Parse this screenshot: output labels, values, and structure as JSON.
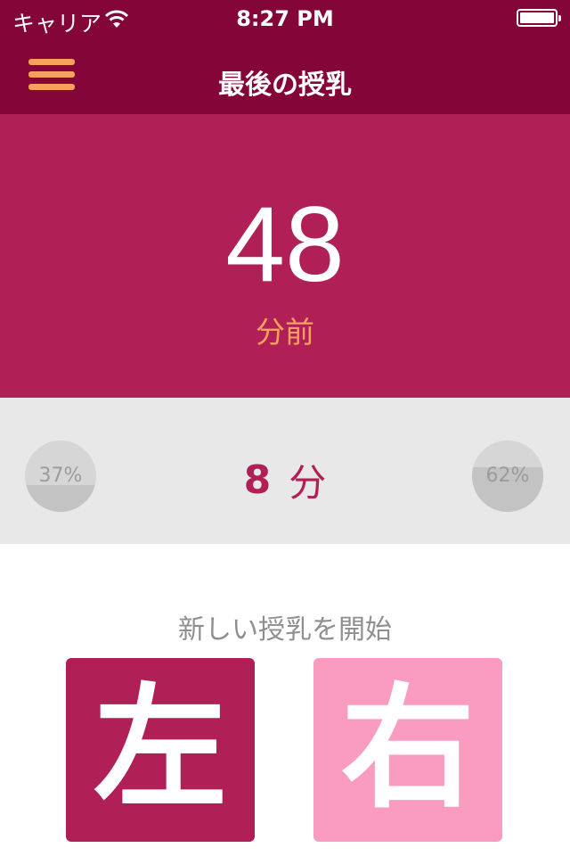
{
  "status_bar": {
    "carrier": "キャリア",
    "time": "8:27 PM",
    "battery_level": 1.0
  },
  "nav": {
    "title": "最後の授乳",
    "menu_icon": "hamburger-menu-icon",
    "accent_color": "#f7a25c",
    "background_color": "#840537"
  },
  "last_feeding": {
    "value": "48",
    "unit": "分前",
    "background_color": "#b01f56"
  },
  "stats": {
    "left_percent_label": "37%",
    "left_percent": 0.37,
    "right_percent_label": "62%",
    "right_percent": 0.62,
    "duration_value": "8",
    "duration_unit": "分"
  },
  "start": {
    "label": "新しい授乳を開始",
    "left_button": "左",
    "right_button": "右",
    "left_color": "#b01f56",
    "right_color": "#f99cbf"
  }
}
